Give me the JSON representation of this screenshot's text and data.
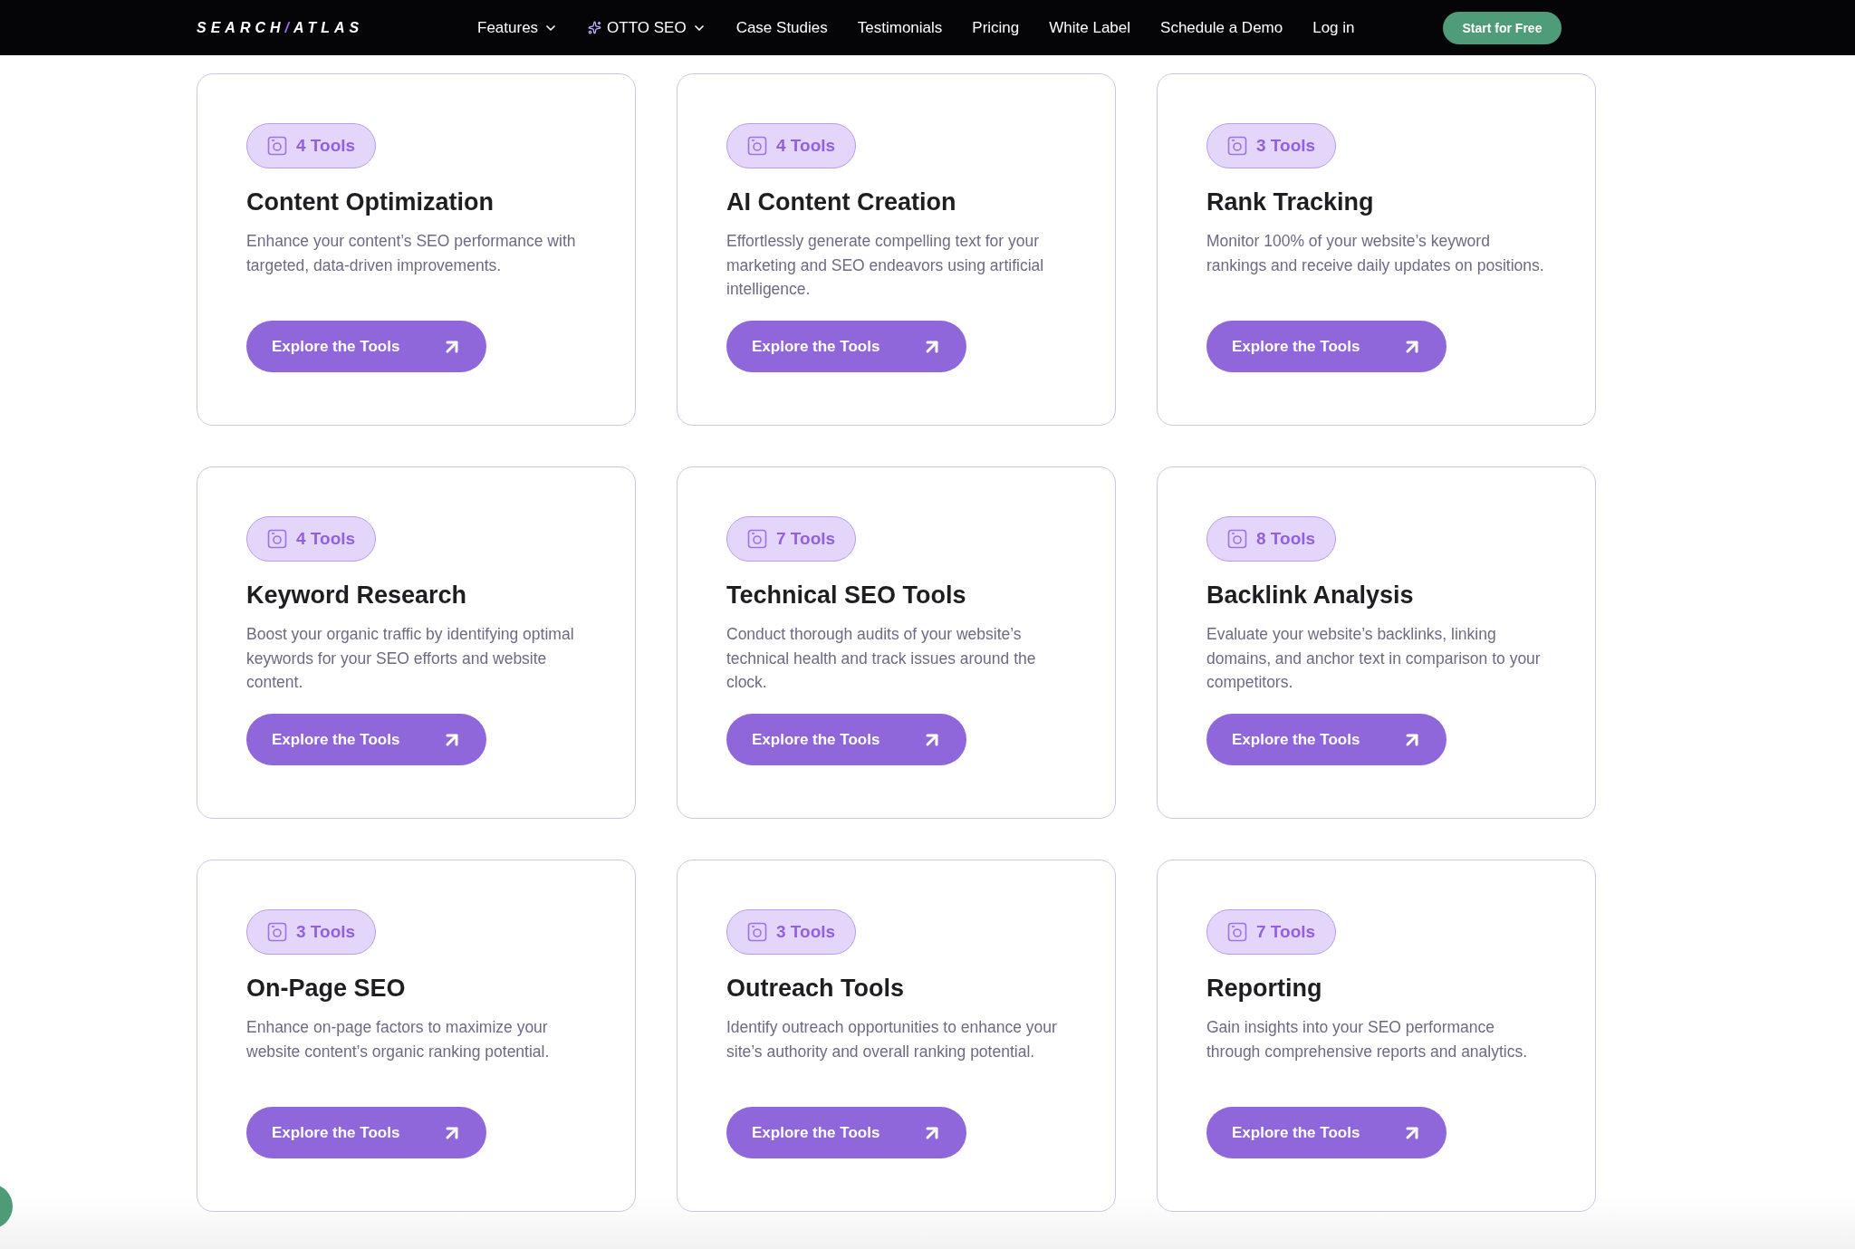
{
  "nav": {
    "logo": [
      {
        "text": "SEARCH",
        "accent": false
      },
      {
        "text": "/",
        "accent": true
      },
      {
        "text": "ATLAS",
        "accent": false
      }
    ],
    "items": [
      {
        "label": "Features",
        "kind": "dropdown",
        "sparkle": false
      },
      {
        "label": "OTTO SEO",
        "kind": "dropdown",
        "sparkle": true
      },
      {
        "label": "Case Studies",
        "kind": "link",
        "sparkle": false
      },
      {
        "label": "Testimonials",
        "kind": "link",
        "sparkle": false
      },
      {
        "label": "Pricing",
        "kind": "link",
        "sparkle": false
      },
      {
        "label": "White Label",
        "kind": "link",
        "sparkle": false
      },
      {
        "label": "Schedule a Demo",
        "kind": "link",
        "sparkle": false
      },
      {
        "label": "Log in",
        "kind": "link",
        "sparkle": false
      }
    ],
    "cta": "Start for Free"
  },
  "cards": [
    {
      "badge": "4 Tools",
      "title": "Content Optimization",
      "description": "Enhance your content’s SEO performance with targeted, data-driven improvements.",
      "button": "Explore the Tools"
    },
    {
      "badge": "4 Tools",
      "title": "AI Content Creation",
      "description": "Effortlessly generate compelling text for your marketing and SEO endeavors using artificial intelligence.",
      "button": "Explore the Tools"
    },
    {
      "badge": "3 Tools",
      "title": "Rank Tracking",
      "description": "Monitor 100% of your website’s keyword rankings  and receive daily updates on positions.",
      "button": "Explore the Tools"
    },
    {
      "badge": "4 Tools",
      "title": "Keyword Research",
      "description": "Boost your organic traffic by identifying optimal keywords for your SEO efforts and website content.",
      "button": "Explore the Tools"
    },
    {
      "badge": "7 Tools",
      "title": "Technical SEO Tools",
      "description": "Conduct thorough audits of your website’s technical health and track issues around the clock.",
      "button": "Explore the Tools"
    },
    {
      "badge": "8 Tools",
      "title": "Backlink Analysis",
      "description": "Evaluate your website’s backlinks, linking domains, and anchor text in comparison to your competitors.",
      "button": "Explore the Tools"
    },
    {
      "badge": "3 Tools",
      "title": "On-Page SEO",
      "description": "Enhance on-page factors to maximize your website content’s organic ranking potential.",
      "button": "Explore the Tools"
    },
    {
      "badge": "3 Tools",
      "title": "Outreach Tools",
      "description": "Identify outreach opportunities to enhance your site’s authority and overall ranking potential.",
      "button": "Explore the Tools"
    },
    {
      "badge": "7 Tools",
      "title": "Reporting",
      "description": "Gain insights into your SEO performance through comprehensive reports and analytics.",
      "button": "Explore the Tools"
    }
  ]
}
